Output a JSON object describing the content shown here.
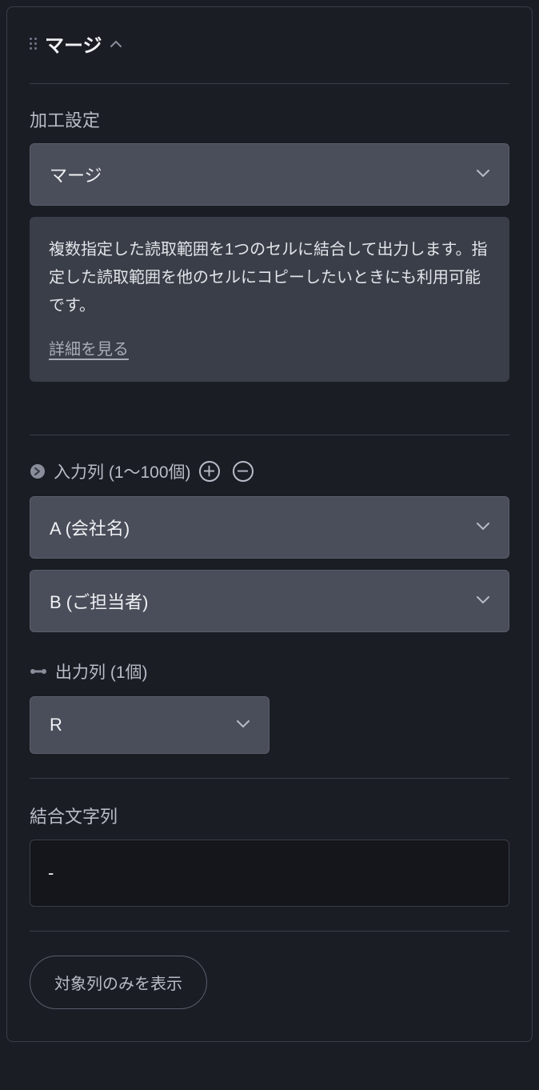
{
  "header": {
    "title": "マージ"
  },
  "processing": {
    "label": "加工設定",
    "selected": "マージ",
    "description": "複数指定した読取範囲を1つのセルに結合して出力します。指定した読取範囲を他のセルにコピーしたいときにも利用可能です。",
    "detail_link": "詳細を見る"
  },
  "input_columns": {
    "label": "入力列 (1〜100個)",
    "items": [
      "A (会社名)",
      "B (ご担当者)"
    ]
  },
  "output_columns": {
    "label": "出力列 (1個)",
    "selected": "R"
  },
  "join_string": {
    "label": "結合文字列",
    "value": "-"
  },
  "footer": {
    "filter_button": "対象列のみを表示"
  }
}
